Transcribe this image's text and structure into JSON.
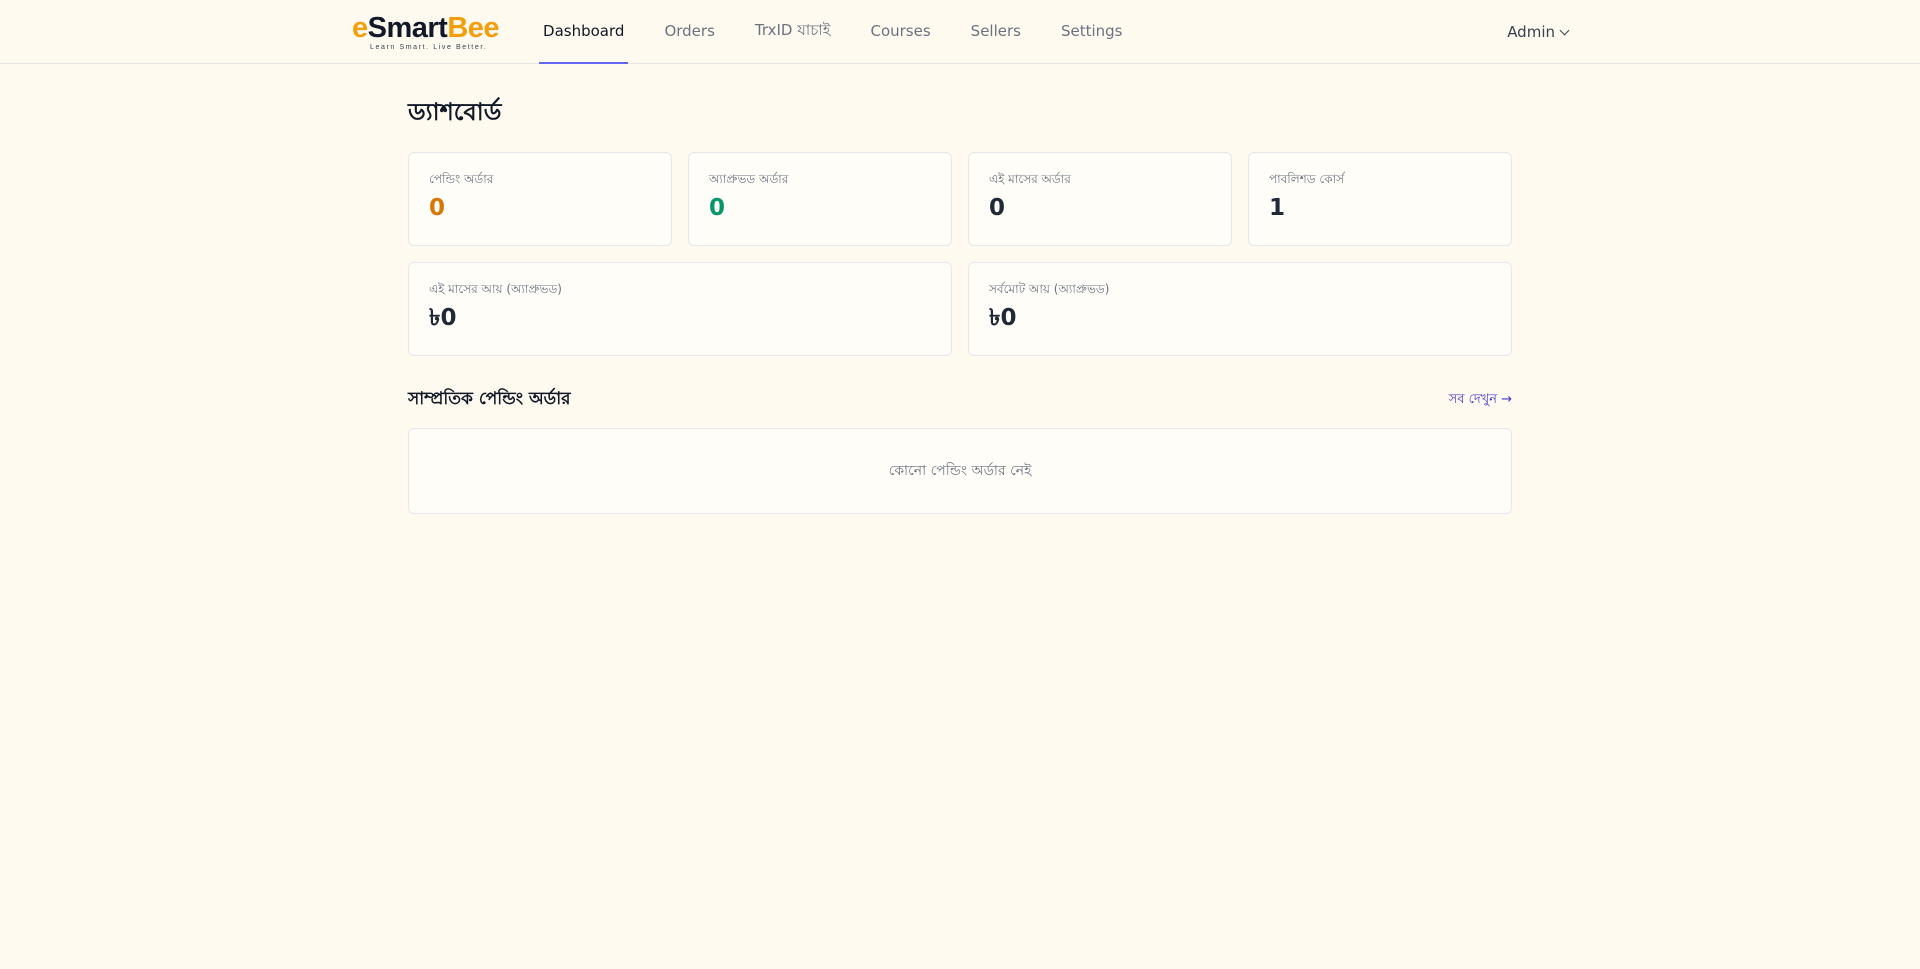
{
  "brand": {
    "logo_e": "e",
    "logo_smart": "Smart",
    "logo_bee": "Bee",
    "tagline": "Learn Smart. Live Better."
  },
  "nav": {
    "links": [
      {
        "label": "Dashboard",
        "active": true
      },
      {
        "label": "Orders"
      },
      {
        "label": "TrxID যাচাই"
      },
      {
        "label": "Courses"
      },
      {
        "label": "Sellers"
      },
      {
        "label": "Settings"
      }
    ],
    "user_label": "Admin",
    "user_icon": "chevron-down-icon"
  },
  "page": {
    "title": "ড্যাশবোর্ড"
  },
  "stats": {
    "top": [
      {
        "label": "পেন্ডিং অর্ডার",
        "value": "0",
        "color": "#d97706"
      },
      {
        "label": "অ্যাপ্রুভড অর্ডার",
        "value": "0",
        "color": "#059669"
      },
      {
        "label": "এই মাসের অর্ডার",
        "value": "0",
        "color": "#1f2937"
      },
      {
        "label": "পাবলিশড কোর্স",
        "value": "1",
        "color": "#1f2937"
      }
    ],
    "revenue": [
      {
        "label": "এই মাসের আয় (অ্যাপ্রুভড)",
        "value": "৳0"
      },
      {
        "label": "সর্বমোট আয় (অ্যাপ্রুভড)",
        "value": "৳0"
      }
    ]
  },
  "pending_section": {
    "title": "সাম্প্রতিক পেন্ডিং অর্ডার",
    "see_all": "সব দেখুন →",
    "empty_text": "কোনো পেন্ডিং অর্ডার নেই"
  },
  "colors": {
    "background": "#fffaf0",
    "accent": "#6366f1",
    "link": "#4338ca",
    "brand_amber": "#f59e0b"
  }
}
